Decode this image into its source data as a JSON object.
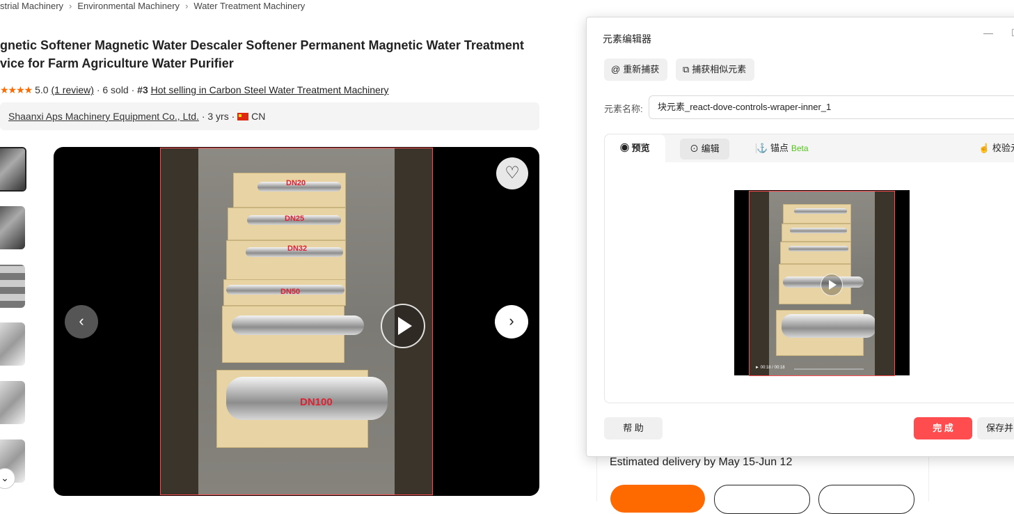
{
  "breadcrumb": {
    "items": [
      "strial Machinery",
      "Environmental Machinery",
      "Water Treatment Machinery"
    ]
  },
  "product": {
    "title_line1": "gnetic Softener Magnetic Water Descaler Softener Permanent Magnetic Water Treatment",
    "title_line2": "vice for Farm Agriculture Water Purifier",
    "rating": "5.0",
    "stars": 5,
    "reviews": "(1 review)",
    "sold": "· 6 sold ·",
    "rank": "#3",
    "rank_text": "Hot selling in Carbon Steel Water Treatment Machinery",
    "supplier": "Shaanxi Aps Machinery Equipment Co., Ltd.",
    "supplier_meta": "· 3 yrs ·",
    "country": "CN",
    "delivery": "Estimated delivery by May 15-Jun 12"
  },
  "viewer": {
    "labels": [
      "DN20",
      "DN25",
      "DN32",
      "DN50",
      "DN100"
    ],
    "prev_icon": "chevron-left-icon",
    "next_icon": "chevron-right-icon",
    "fav_icon": "heart-icon"
  },
  "editor": {
    "title": "元素编辑器",
    "minimize": "—",
    "maximize": "☐",
    "recapture": "重新捕获",
    "capture_similar": "捕获相似元素",
    "name_label": "元素名称:",
    "name_value": "块元素_react-dove-controls-wraper-inner_1",
    "tabs": {
      "preview": "预览",
      "edit": "编辑",
      "anchor": "锚点",
      "beta": "Beta",
      "verify": "校验元"
    },
    "mini_time": "00:18 / 00:18",
    "help": "帮 助",
    "done": "完 成",
    "save": "保存并"
  },
  "colors": {
    "accent_orange": "#ff6a00",
    "done_red": "#ff4d4f",
    "beta_green": "#52c41a"
  }
}
